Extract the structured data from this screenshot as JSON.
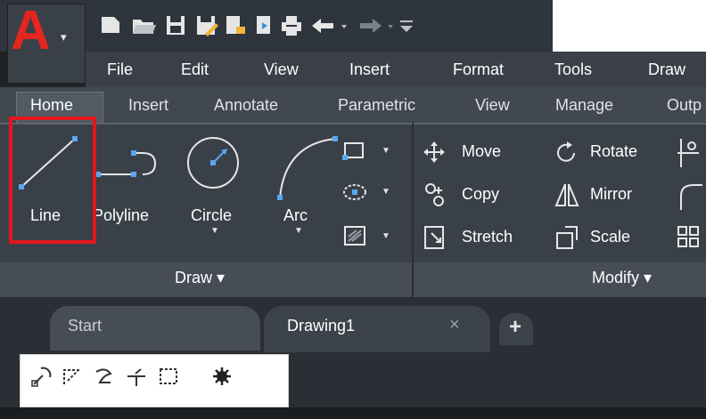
{
  "app": {
    "logo_letter": "A",
    "logo_color": "#e3261f"
  },
  "quick_access": {
    "icons": [
      "new-icon",
      "open-icon",
      "save-icon",
      "save-as-icon",
      "cloud-open-icon",
      "cloud-save-icon",
      "plot-icon",
      "undo-icon",
      "redo-icon",
      "customize-icon"
    ]
  },
  "menu": {
    "items": [
      "File",
      "Edit",
      "View",
      "Insert",
      "Format",
      "Tools",
      "Draw"
    ]
  },
  "ribbon_tabs": {
    "items": [
      "Home",
      "Insert",
      "Annotate",
      "Parametric",
      "View",
      "Manage",
      "Outp"
    ],
    "active": "Home"
  },
  "draw_panel": {
    "title": "Draw ▾",
    "line": "Line",
    "polyline": "Polyline",
    "circle": "Circle",
    "arc": "Arc",
    "highlight_color": "#e3161d"
  },
  "modify_panel": {
    "title": "Modify ▾",
    "move": "Move",
    "rotate": "Rotate",
    "copy": "Copy",
    "mirror": "Mirror",
    "stretch": "Stretch",
    "scale": "Scale"
  },
  "doc_tabs": {
    "start": "Start",
    "drawing": "Drawing1",
    "close": "×",
    "add": "+"
  },
  "toolbar": {
    "icons": [
      "osnap-icon",
      "snap-track-icon",
      "polar-icon",
      "ortho-icon",
      "rectangle-icon",
      "settings-icon"
    ]
  }
}
